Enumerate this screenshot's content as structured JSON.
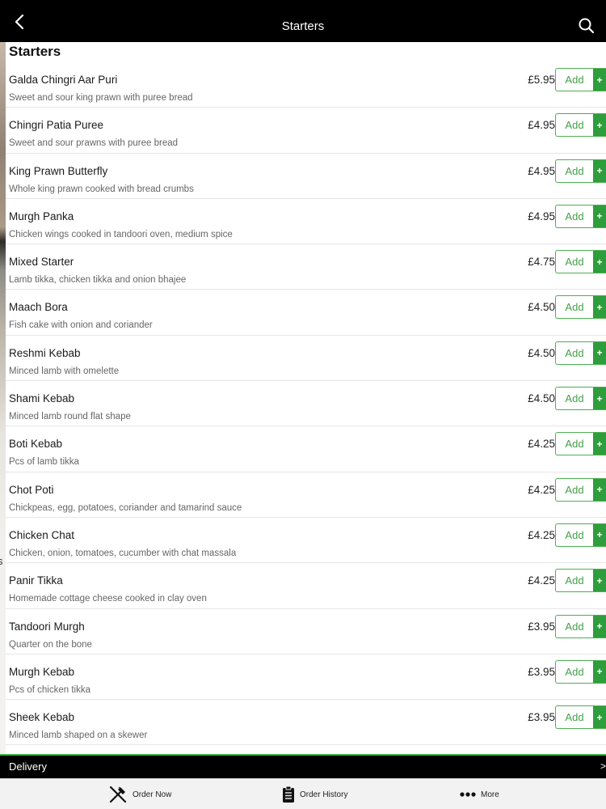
{
  "header": {
    "title": "Starters"
  },
  "section": {
    "title": "Starters"
  },
  "items": [
    {
      "name": "Galda Chingri Aar Puri",
      "description": "Sweet and sour king prawn with puree bread",
      "price": "£5.95",
      "add_label": "Add",
      "plus": "+"
    },
    {
      "name": "Chingri Patia Puree",
      "description": "Sweet and sour prawns with puree bread",
      "price": "£4.95",
      "add_label": "Add",
      "plus": "+"
    },
    {
      "name": "King Prawn Butterfly",
      "description": "Whole king prawn cooked with bread crumbs",
      "price": "£4.95",
      "add_label": "Add",
      "plus": "+"
    },
    {
      "name": "Murgh Panka",
      "description": "Chicken wings cooked in tandoori oven, medium spice",
      "price": "£4.95",
      "add_label": "Add",
      "plus": "+"
    },
    {
      "name": "Mixed Starter",
      "description": "Lamb tikka, chicken tikka and onion bhajee",
      "price": "£4.75",
      "add_label": "Add",
      "plus": "+"
    },
    {
      "name": "Maach Bora",
      "description": "Fish cake with onion and coriander",
      "price": "£4.50",
      "add_label": "Add",
      "plus": "+"
    },
    {
      "name": "Reshmi Kebab",
      "description": "Minced lamb with omelette",
      "price": "£4.50",
      "add_label": "Add",
      "plus": "+"
    },
    {
      "name": "Shami Kebab",
      "description": "Minced lamb round flat shape",
      "price": "£4.50",
      "add_label": "Add",
      "plus": "+"
    },
    {
      "name": "Boti Kebab",
      "description": "Pcs of lamb tikka",
      "price": "£4.25",
      "add_label": "Add",
      "plus": "+"
    },
    {
      "name": "Chot Poti",
      "description": "Chickpeas, egg, potatoes, coriander and tamarind sauce",
      "price": "£4.25",
      "add_label": "Add",
      "plus": "+"
    },
    {
      "name": "Chicken Chat",
      "description": "Chicken, onion, tomatoes, cucumber with chat massala",
      "price": "£4.25",
      "add_label": "Add",
      "plus": "+"
    },
    {
      "name": "Panir Tikka",
      "description": "Homemade cottage cheese cooked in clay oven",
      "price": "£4.25",
      "add_label": "Add",
      "plus": "+"
    },
    {
      "name": "Tandoori Murgh",
      "description": "Quarter on the bone",
      "price": "£3.95",
      "add_label": "Add",
      "plus": "+"
    },
    {
      "name": "Murgh Kebab",
      "description": "Pcs of chicken tikka",
      "price": "£3.95",
      "add_label": "Add",
      "plus": "+"
    },
    {
      "name": "Sheek Kebab",
      "description": "Minced lamb shaped on a skewer",
      "price": "£3.95",
      "add_label": "Add",
      "plus": "+"
    }
  ],
  "background_fragment": "s",
  "delivery": {
    "label": "Delivery",
    "arrow": ">"
  },
  "tabbar": [
    {
      "label": "Order Now",
      "icon": "fork-knife-icon"
    },
    {
      "label": "Order History",
      "icon": "clipboard-icon"
    },
    {
      "label": "More",
      "icon": "more-dots-icon"
    }
  ],
  "colors": {
    "accent": "#43a047",
    "accent_dark": "#2e9d3c",
    "bar": "#000000"
  }
}
